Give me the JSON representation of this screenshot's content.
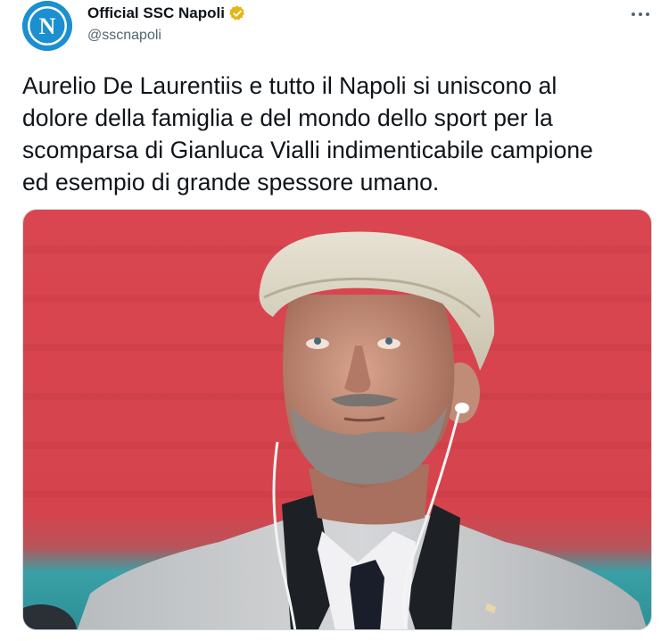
{
  "author": {
    "display_name": "Official SSC Napoli",
    "handle": "@sscnapoli",
    "verified": true,
    "avatar_letter": "N"
  },
  "icons": {
    "verified": "verified-badge-icon",
    "more": "more-options-icon"
  },
  "tweet": {
    "lines": [
      "Aurelio De Laurentiis e tutto il Napoli si uniscono al",
      "dolore della famiglia e del mondo dello sport per la",
      "scomparsa di Gianluca Vialli indimenticabile campione",
      "ed esempio di grande spessore umano."
    ]
  },
  "colors": {
    "brand_blue": "#1b8fd0",
    "verified_gold": "#e2b719",
    "text_primary": "#0f1419",
    "text_secondary": "#536471",
    "photo_background": "#d8434b"
  }
}
